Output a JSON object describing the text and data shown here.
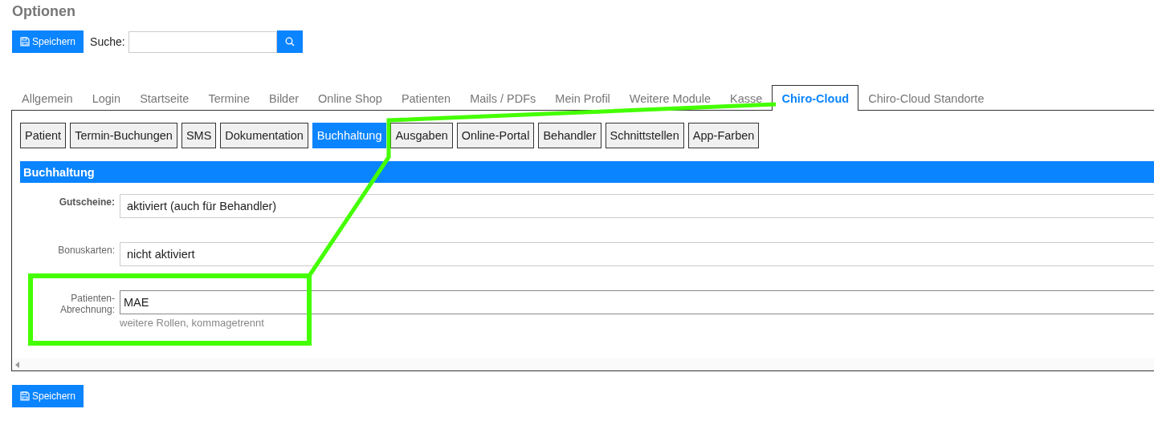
{
  "title": "Optionen",
  "toolbar": {
    "save": "Speichern",
    "search_label": "Suche:"
  },
  "tabs": [
    {
      "label": "Allgemein",
      "selected": false
    },
    {
      "label": "Login",
      "selected": false
    },
    {
      "label": "Startseite",
      "selected": false
    },
    {
      "label": "Termine",
      "selected": false
    },
    {
      "label": "Bilder",
      "selected": false
    },
    {
      "label": "Online Shop",
      "selected": false
    },
    {
      "label": "Patienten",
      "selected": false
    },
    {
      "label": "Mails / PDFs",
      "selected": false
    },
    {
      "label": "Mein Profil",
      "selected": false
    },
    {
      "label": "Weitere Module",
      "selected": false
    },
    {
      "label": "Kasse",
      "selected": false
    },
    {
      "label": "Chiro-Cloud",
      "selected": true
    },
    {
      "label": "Chiro-Cloud Standorte",
      "selected": false
    }
  ],
  "subtabs": [
    {
      "label": "Patient",
      "selected": false
    },
    {
      "label": "Termin-Buchungen",
      "selected": false
    },
    {
      "label": "SMS",
      "selected": false
    },
    {
      "label": "Dokumentation",
      "selected": false
    },
    {
      "label": "Buchhaltung",
      "selected": true
    },
    {
      "label": "Ausgaben",
      "selected": false
    },
    {
      "label": "Online-Portal",
      "selected": false
    },
    {
      "label": "Behandler",
      "selected": false
    },
    {
      "label": "Schnittstellen",
      "selected": false
    },
    {
      "label": "App-Farben",
      "selected": false
    }
  ],
  "section": {
    "title": "Buchhaltung",
    "fields": [
      {
        "kind": "select",
        "label": "Gutscheine:",
        "bold": true,
        "value": "aktiviert (auch für Behandler)"
      },
      {
        "kind": "select",
        "label": "Bonuskarten:",
        "bold": false,
        "value": "nicht aktiviert"
      },
      {
        "kind": "text",
        "label": "Patienten-Abrechnung:",
        "bold": false,
        "value": "MAE",
        "hint": "weitere Rollen, kommagetrennt"
      }
    ]
  },
  "footer": {
    "save": "Speichern"
  }
}
